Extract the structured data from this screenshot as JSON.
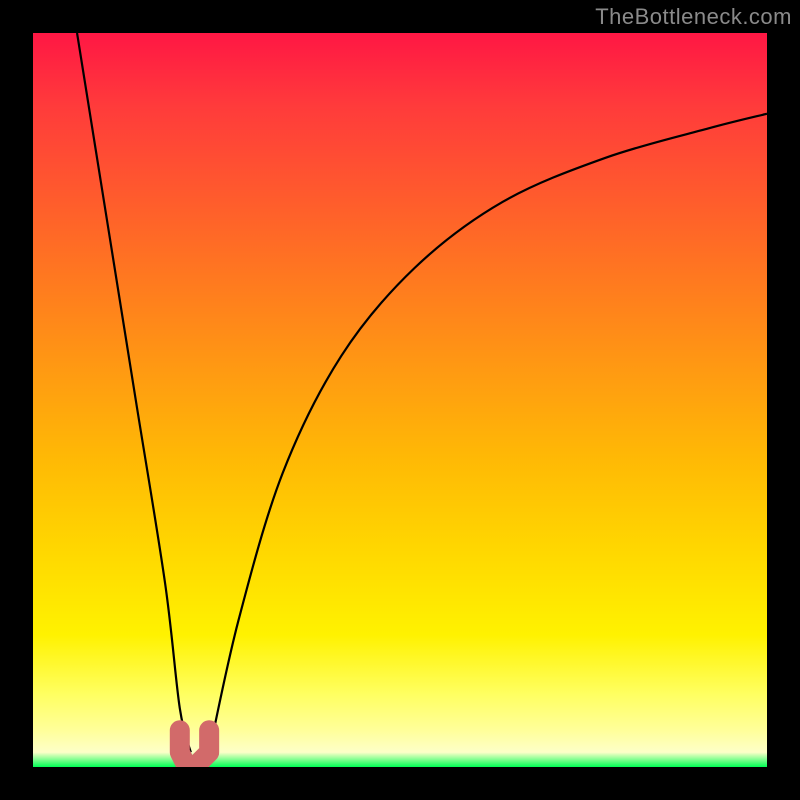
{
  "watermark": "TheBottleneck.com",
  "chart_data": {
    "type": "line",
    "title": "",
    "xlabel": "",
    "ylabel": "",
    "xlim": [
      0,
      100
    ],
    "ylim": [
      0,
      100
    ],
    "grid": false,
    "legend": false,
    "background": "gradient-red-to-green",
    "series": [
      {
        "name": "left-branch",
        "x": [
          6,
          10,
          14,
          18,
          20,
          21.5
        ],
        "y": [
          100,
          75,
          50,
          25,
          8,
          2
        ]
      },
      {
        "name": "right-branch",
        "x": [
          24,
          28,
          34,
          42,
          52,
          64,
          78,
          92,
          100
        ],
        "y": [
          2,
          20,
          40,
          56,
          68,
          77,
          83,
          87,
          89
        ]
      },
      {
        "name": "u-marker",
        "x": [
          20,
          20,
          21,
          22,
          24,
          24
        ],
        "y": [
          5,
          2,
          0,
          0,
          2,
          5
        ],
        "color": "#d26a6a",
        "stroke_width": 4
      }
    ]
  }
}
